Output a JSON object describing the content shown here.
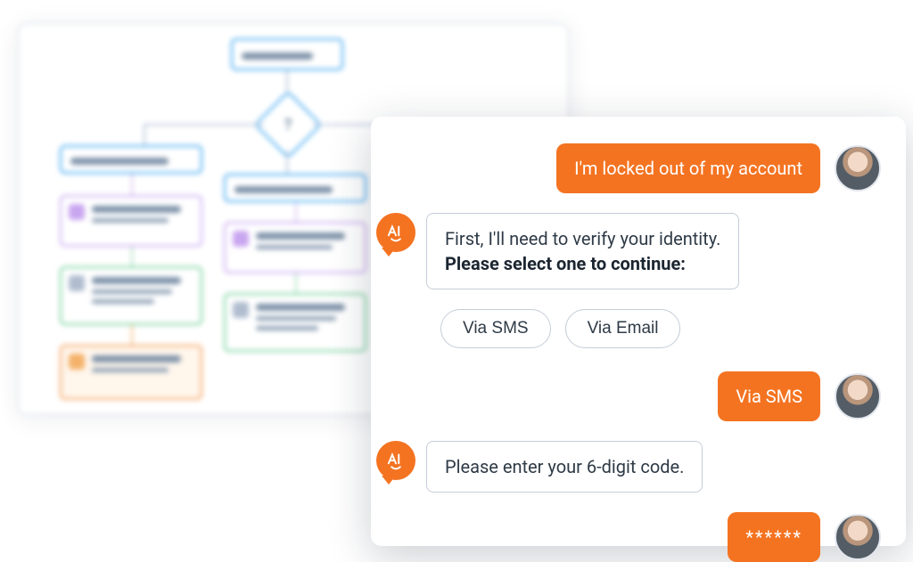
{
  "colors": {
    "accent": "#f47321",
    "border": "#c6cdd8",
    "text": "#2e3a46",
    "textStrong": "#1b2530"
  },
  "flowchart": {
    "description": "Blurred decision-tree flowchart background with color-coded nodes (blue, purple, green, orange) and a central diamond decision node."
  },
  "chat": {
    "messages": {
      "user1": "I'm locked out of my account",
      "bot1_line1": "First, I'll need to verify your identity.",
      "bot1_line2": "Please select one to continue:",
      "option_sms": "Via SMS",
      "option_email": "Via Email",
      "user2": "Via SMS",
      "bot2": "Please enter your 6-digit code.",
      "user3": "******"
    },
    "ai_badge_label": "AI"
  }
}
